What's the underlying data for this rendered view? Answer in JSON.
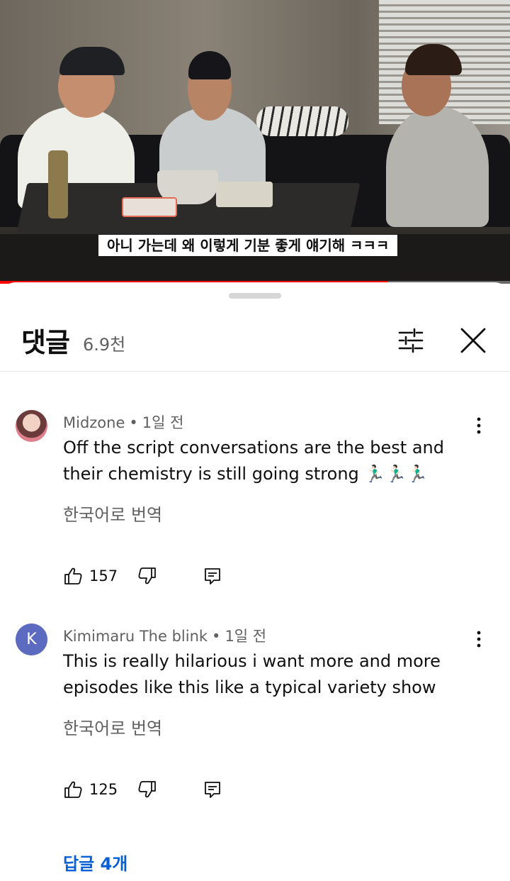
{
  "video": {
    "subtitle": "아니 가는데 왜 이렇게 기분 좋게 얘기해 ㅋㅋㅋ",
    "progress_fraction": 0.76
  },
  "comments_panel": {
    "title": "댓글",
    "count": "6.9천",
    "icons": {
      "filter": "sort-filter-icon",
      "close": "close-icon"
    }
  },
  "comments": [
    {
      "author": "Midzone",
      "separator": "•",
      "time": "1일 전",
      "text": "Off the script conversations are the best and their chemistry is still  going strong 🏃🏻‍♂️🏃🏻‍♂️🏃🏻‍♂️",
      "translate_label": "한국어로 번역",
      "likes": "157",
      "avatar_type": "photo"
    },
    {
      "author": "Kimimaru The blink",
      "separator": "•",
      "time": "1일 전",
      "text": "This is really hilarious i want more and more episodes like this like a typical variety show",
      "translate_label": "한국어로 번역",
      "likes": "125",
      "avatar_letter": "K",
      "avatar_color": "#5c6bc0",
      "replies_label": "답글 4개"
    }
  ],
  "colors": {
    "link": "#065fd4",
    "progress": "#ff0000",
    "secondary_text": "#606060"
  }
}
